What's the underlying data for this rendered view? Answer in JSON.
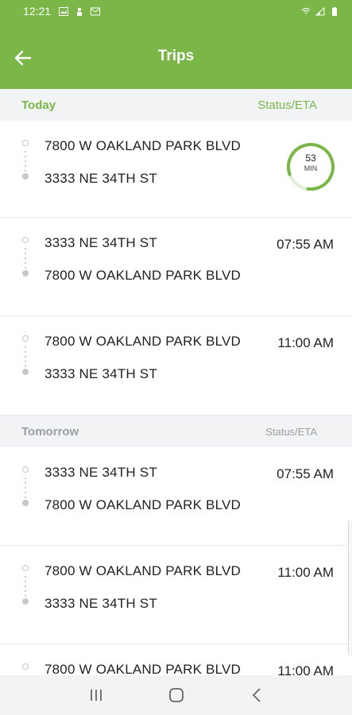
{
  "status_bar": {
    "time": "12:21",
    "icons": [
      "image-icon",
      "person-icon",
      "mail-icon"
    ],
    "right_icons": [
      "wifi-icon",
      "signal-icon",
      "battery-icon"
    ]
  },
  "header": {
    "title": "Trips",
    "back_icon": "back-arrow-icon",
    "accent_color": "#7ab648"
  },
  "sections": [
    {
      "label": "Today",
      "status_label": "Status/ETA",
      "trips": [
        {
          "from": "7800 W OAKLAND PARK BLVD",
          "to": "3333 NE 34TH ST",
          "eta": {
            "value": "53",
            "unit": "MIN"
          }
        },
        {
          "from": "3333 NE 34TH ST",
          "to": "7800 W OAKLAND PARK BLVD",
          "time": "07:55 AM"
        },
        {
          "from": "7800 W OAKLAND PARK BLVD",
          "to": "3333 NE 34TH ST",
          "time": "11:00 AM"
        }
      ]
    },
    {
      "label": "Tomorrow",
      "status_label": "Status/ETA",
      "trips": [
        {
          "from": "3333 NE 34TH ST",
          "to": "7800 W OAKLAND PARK BLVD",
          "time": "07:55 AM"
        },
        {
          "from": "7800 W OAKLAND PARK BLVD",
          "to": "3333 NE 34TH ST",
          "time": "11:00 AM"
        },
        {
          "from": "7800 W OAKLAND PARK BLVD",
          "time": "11:00 AM"
        }
      ]
    }
  ],
  "nav_bar": {
    "buttons": [
      "recents-icon",
      "home-icon",
      "back-icon"
    ]
  }
}
